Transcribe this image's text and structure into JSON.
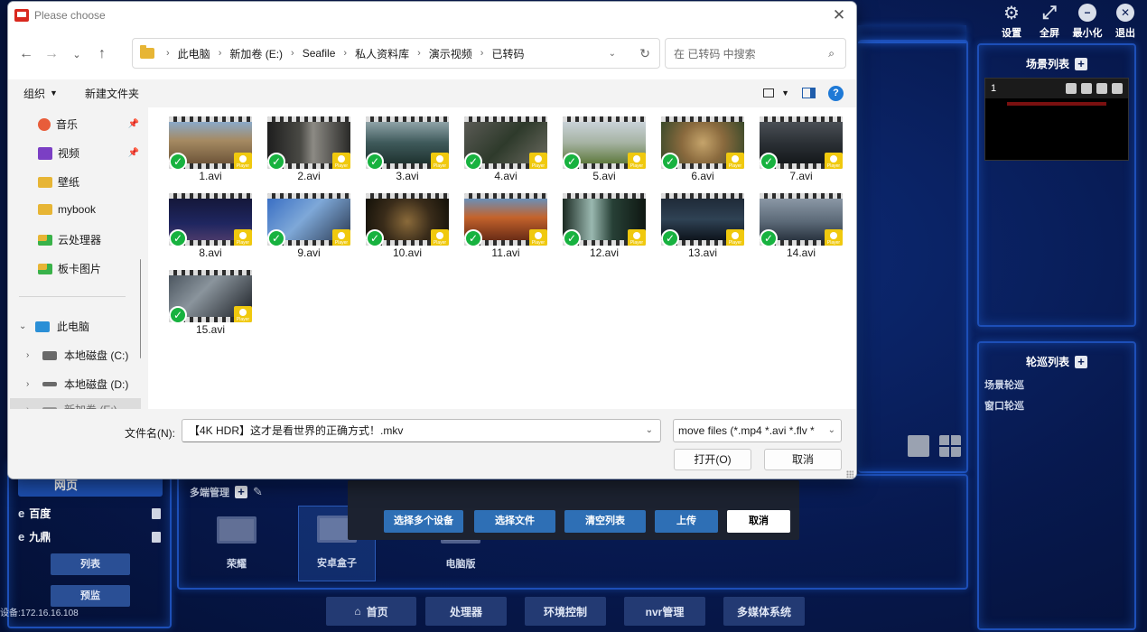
{
  "app": {
    "top_tools": [
      {
        "label": "设置",
        "icon": "gear-icon",
        "glyph": "⚙"
      },
      {
        "label": "全屏",
        "icon": "fullscreen-icon",
        "glyph": "⤢"
      },
      {
        "label": "最小化",
        "icon": "minimize-icon",
        "glyph": "−"
      },
      {
        "label": "退出",
        "icon": "exit-icon",
        "glyph": "✕"
      }
    ],
    "scene_list_title": "场景列表",
    "scene_card_number": "1",
    "tour_list_title": "轮巡列表",
    "tour_items": [
      "场景轮巡",
      "窗口轮巡"
    ],
    "web_button_label": "网页",
    "left_items": [
      "百度",
      "九鼎"
    ],
    "list_button": "列表",
    "preview_button": "预监",
    "device_ip": "设备:172.16.16.108",
    "multi_manage_title": "多端管理",
    "devices": [
      "荣耀",
      "安卓盒子",
      "电脑版"
    ],
    "upload_buttons": [
      "选择多个设备",
      "选择文件",
      "清空列表",
      "上传",
      "取消"
    ],
    "bottom_nav": [
      "首页",
      "处理器",
      "环境控制",
      "nvr管理",
      "多媒体系统"
    ]
  },
  "dialog": {
    "title": "Please choose",
    "breadcrumbs": [
      "此电脑",
      "新加卷 (E:)",
      "Seafile",
      "私人资料库",
      "演示视频",
      "已转码"
    ],
    "search_placeholder": "在 已转码 中搜索",
    "toolbar": {
      "organize": "组织",
      "new_folder": "新建文件夹"
    },
    "sidebar_quick": [
      {
        "label": "音乐",
        "color": "#e85d3a",
        "pinned": true
      },
      {
        "label": "视频",
        "color": "#7b3fc4",
        "pinned": true
      },
      {
        "label": "壁纸",
        "color": "#e7b535",
        "pinned": false
      },
      {
        "label": "mybook",
        "color": "#e7b535",
        "pinned": false
      },
      {
        "label": "云处理器",
        "color": "#e7b535",
        "pinned": false
      },
      {
        "label": "板卡图片",
        "color": "#e7b535",
        "pinned": false
      }
    ],
    "tree": [
      {
        "label": "此电脑",
        "arrow": "⌄"
      },
      {
        "label": "本地磁盘 (C:)",
        "arrow": "›"
      },
      {
        "label": "本地磁盘 (D:)",
        "arrow": "›"
      },
      {
        "label": "新加卷 (E:)",
        "arrow": "›"
      }
    ],
    "files": [
      {
        "name": "1.avi",
        "bg": "linear-gradient(180deg,#8aa9c9 0%,#a58a62 45%,#6e5539 100%)"
      },
      {
        "name": "2.avi",
        "bg": "linear-gradient(90deg,#1e1e1e 0%,#4a4a45 40%,#8c8a84 55%,#2a2a28 100%)"
      },
      {
        "name": "3.avi",
        "bg": "linear-gradient(180deg,#8fa3a8 0%,#3f5a5b 50%,#1f3330 100%)"
      },
      {
        "name": "4.avi",
        "bg": "linear-gradient(135deg,#5a5a55 0%,#2e3a2b 50%,#6b6a60 100%)"
      },
      {
        "name": "5.avi",
        "bg": "linear-gradient(180deg,#c9d2d8 0%,#a6b3a3 50%,#5f7a3f 100%)"
      },
      {
        "name": "6.avi",
        "bg": "radial-gradient(circle at 50% 50%,#c5a46b 0%,#8a6a3e 45%,#3a4a2a 100%)"
      },
      {
        "name": "7.avi",
        "bg": "linear-gradient(180deg,#4a4f55 0%,#2c3136 50%,#15181b 100%)"
      },
      {
        "name": "8.avi",
        "bg": "linear-gradient(180deg,#14173a 0%,#1f2660 60%,#4a3a6a 100%)"
      },
      {
        "name": "9.avi",
        "bg": "linear-gradient(135deg,#3a6fc4 0%,#7ea8d8 45%,#2b3a52 100%)"
      },
      {
        "name": "10.avi",
        "bg": "radial-gradient(circle at 50% 55%,#8a6a3a 0%,#3a2c1a 50%,#121008 100%)"
      },
      {
        "name": "11.avi",
        "bg": "linear-gradient(180deg,#6a8fb8 0%,#c4632c 45%,#6a2c16 100%)"
      },
      {
        "name": "12.avi",
        "bg": "linear-gradient(90deg,#1b2a22 0%,#9ab8b0 35%,#274036 60%,#0f1712 100%)"
      },
      {
        "name": "13.avi",
        "bg": "linear-gradient(180deg,#1f2a38 0%,#2f4254 50%,#0e141c 100%)"
      },
      {
        "name": "14.avi",
        "bg": "linear-gradient(180deg,#8a97a5 0%,#5c6a78 55%,#2a3440 100%)"
      },
      {
        "name": "15.avi",
        "bg": "linear-gradient(135deg,#4c5660 0%,#8a949c 40%,#1c2026 100%)"
      }
    ],
    "filename_label": "文件名(N):",
    "filename_value": "【4K HDR】这才是看世界的正确方式！.mkv",
    "filetype_value": "move files (*.mp4 *.avi *.flv *",
    "open_button": "打开(O)",
    "cancel_button": "取消"
  }
}
